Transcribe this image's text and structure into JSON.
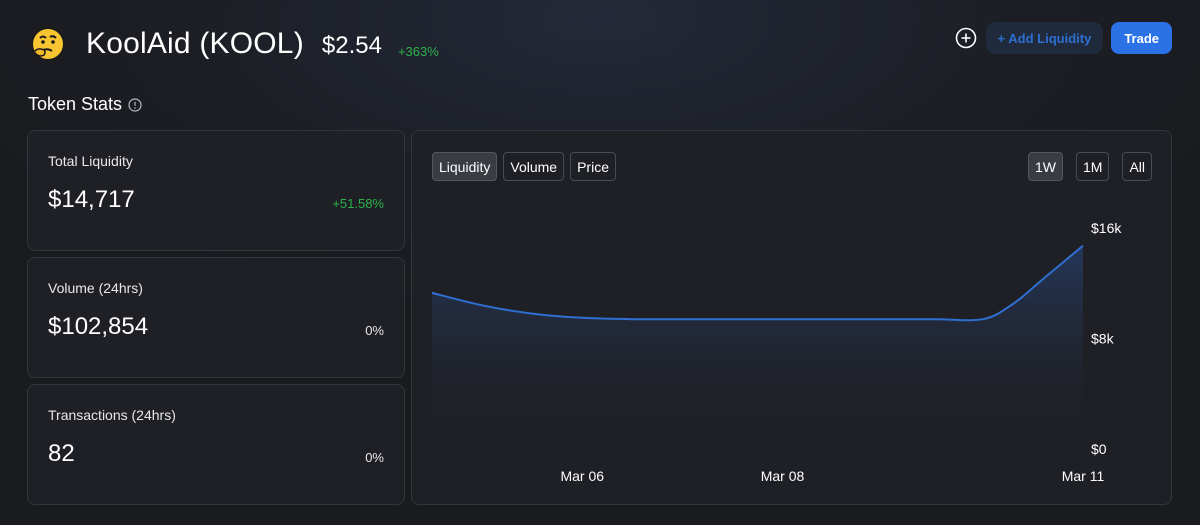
{
  "token": {
    "emoji": "🤔",
    "name": "KoolAid (KOOL)",
    "price": "$2.54",
    "change": "+363%"
  },
  "actions": {
    "add_liquidity_label": "+ Add Liquidity",
    "trade_label": "Trade"
  },
  "section": {
    "title": "Token Stats"
  },
  "stats": [
    {
      "label": "Total Liquidity",
      "value": "$14,717",
      "change": "+51.58%"
    },
    {
      "label": "Volume (24hrs)",
      "value": "$102,854",
      "change": "0%"
    },
    {
      "label": "Transactions (24hrs)",
      "value": "82",
      "change": "0%"
    }
  ],
  "chart_tabs": [
    "Liquidity",
    "Volume",
    "Price"
  ],
  "chart_ranges": [
    "1W",
    "1M",
    "All"
  ],
  "colors": {
    "accent": "#2a72e6",
    "positive": "#2bb24a",
    "line": "#2f6fd1"
  },
  "chart_data": {
    "type": "area",
    "title": "",
    "xlabel": "",
    "ylabel": "",
    "x_tick_labels": [
      "Mar 06",
      "Mar 08",
      "Mar 11"
    ],
    "x_tick_positions": [
      1.5,
      3.5,
      6.5
    ],
    "y_tick_labels": [
      "$0",
      "$8k",
      "$16k"
    ],
    "y_tick_values": [
      0,
      8000,
      16000
    ],
    "ylim": [
      0,
      16000
    ],
    "xlim": [
      0,
      6.5
    ],
    "grid": false,
    "legend": "none",
    "series": [
      {
        "values": [
          [
            0,
            11300
          ],
          [
            0.5,
            10400
          ],
          [
            1,
            9800
          ],
          [
            1.5,
            9500
          ],
          [
            2,
            9400
          ],
          [
            3,
            9400
          ],
          [
            4,
            9400
          ],
          [
            5,
            9400
          ],
          [
            5.5,
            9400
          ],
          [
            5.8,
            10500
          ],
          [
            6.1,
            12300
          ],
          [
            6.5,
            14717
          ]
        ]
      }
    ]
  }
}
